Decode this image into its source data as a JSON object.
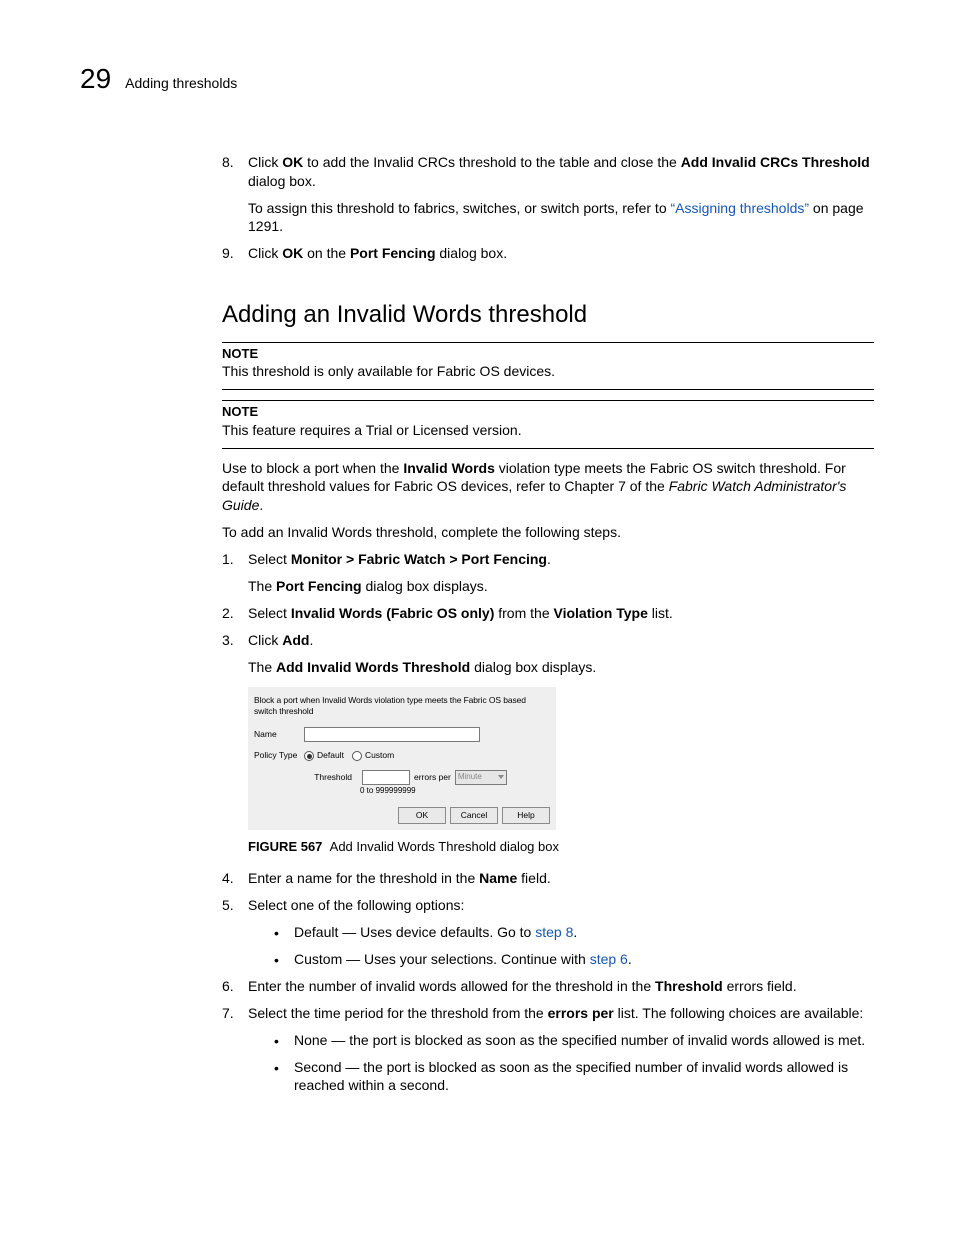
{
  "header": {
    "chapter_number": "29",
    "chapter_title": "Adding thresholds"
  },
  "intro_steps": {
    "s8": {
      "n": "8.",
      "t1a": "Click ",
      "t1b": "OK",
      "t1c": " to add the Invalid CRCs threshold to the table and close the ",
      "t1d": "Add Invalid CRCs Threshold",
      "t1e": " dialog box.",
      "t2a": "To assign this threshold to fabrics, switches, or switch ports, refer to ",
      "t2b": "“Assigning thresholds”",
      "t2c": " on page 1291."
    },
    "s9": {
      "n": "9.",
      "t1a": "Click ",
      "t1b": "OK",
      "t1c": " on the ",
      "t1d": "Port Fencing",
      "t1e": " dialog box."
    }
  },
  "section_title": "Adding an Invalid Words threshold",
  "note1": {
    "label": "NOTE",
    "text": "This threshold is only available for Fabric OS devices."
  },
  "note2": {
    "label": "NOTE",
    "text": "This feature requires a Trial or Licensed version."
  },
  "para1": {
    "a": "Use to block a port when the ",
    "b": "Invalid Words",
    "c": " violation type meets the Fabric OS switch threshold. For default threshold values for Fabric OS devices, refer to Chapter 7 of the ",
    "d": "Fabric Watch Administrator's Guide",
    "e": "."
  },
  "para2": "To add an Invalid Words threshold, complete the following steps.",
  "steps": {
    "s1": {
      "n": "1.",
      "a": "Select ",
      "b": "Monitor > Fabric Watch > Port Fencing",
      "c": ".",
      "p2a": "The ",
      "p2b": "Port Fencing",
      "p2c": " dialog box displays."
    },
    "s2": {
      "n": "2.",
      "a": "Select ",
      "b": "Invalid Words (Fabric OS only)",
      "c": " from the ",
      "d": "Violation Type",
      "e": " list."
    },
    "s3": {
      "n": "3.",
      "a": "Click ",
      "b": "Add",
      "c": ".",
      "p2a": "The ",
      "p2b": "Add Invalid Words Threshold",
      "p2c": " dialog box displays."
    },
    "s4": {
      "n": "4.",
      "a": "Enter a name for the threshold in the ",
      "b": "Name",
      "c": " field."
    },
    "s5": {
      "n": "5.",
      "a": "Select one of the following options:",
      "b1a": "Default — Uses device defaults. Go to ",
      "b1b": "step 8",
      "b1c": ".",
      "b2a": "Custom — Uses your selections. Continue with ",
      "b2b": "step 6",
      "b2c": "."
    },
    "s6": {
      "n": "6.",
      "a": "Enter the number of invalid words allowed for the threshold in the ",
      "b": "Threshold",
      "c": " errors field."
    },
    "s7": {
      "n": "7.",
      "a": "Select the time period for the threshold from the ",
      "b": "errors per",
      "c": " list. The following choices are available:",
      "b1": "None — the port is blocked as soon as the specified number of invalid words allowed is met.",
      "b2": "Second — the port is blocked as soon as the specified number of invalid words allowed is reached within a second."
    }
  },
  "dialog": {
    "desc": "Block a port when Invalid Words violation type meets the Fabric OS based switch threshold",
    "name_label": "Name",
    "name_value": "",
    "policy_label": "Policy Type",
    "radio_default": "Default",
    "radio_custom": "Custom",
    "threshold_label": "Threshold",
    "threshold_value": "",
    "errors_per": "errors per",
    "unit": "Minute",
    "hint": "0 to 999999999",
    "btn_ok": "OK",
    "btn_cancel": "Cancel",
    "btn_help": "Help"
  },
  "figure": {
    "num": "FIGURE 567",
    "caption": "Add Invalid Words Threshold dialog box"
  }
}
